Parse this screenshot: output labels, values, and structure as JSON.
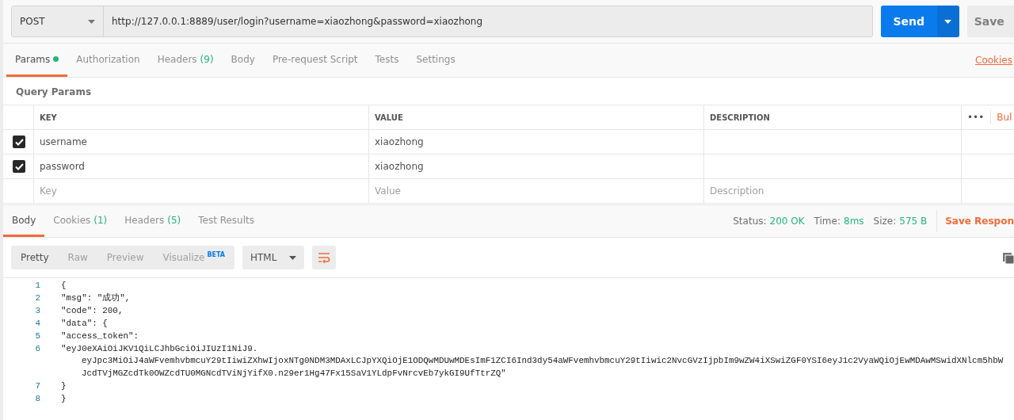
{
  "request": {
    "method": "POST",
    "url": "http://127.0.0.1:8889/user/login?username=xiaozhong&password=xiaozhong",
    "send": "Send",
    "save": "Save"
  },
  "request_tabs": [
    {
      "label": "Params",
      "dot": true,
      "selected": true
    },
    {
      "label": "Authorization",
      "dot": false,
      "selected": false
    },
    {
      "label": "Headers",
      "count": "(9)",
      "dot": false,
      "selected": false
    },
    {
      "label": "Body",
      "dot": false,
      "selected": false
    },
    {
      "label": "Pre-request Script",
      "dot": false,
      "selected": false
    },
    {
      "label": "Tests",
      "dot": false,
      "selected": false
    },
    {
      "label": "Settings",
      "dot": false,
      "selected": false
    }
  ],
  "cookies_link": "Cookies",
  "query_params": {
    "title": "Query Params",
    "columns": [
      "KEY",
      "VALUE",
      "DESCRIPTION"
    ],
    "more": "•••",
    "bulk_edit": "Bul",
    "rows": [
      {
        "checked": true,
        "key": "username",
        "value": "xiaozhong"
      },
      {
        "checked": true,
        "key": "password",
        "value": "xiaozhong"
      }
    ],
    "new_row": {
      "key_placeholder": "Key",
      "value_placeholder": "Value",
      "description_placeholder": "Description"
    }
  },
  "response_tabs": [
    {
      "label": "Body",
      "selected": true
    },
    {
      "label": "Cookies",
      "count": "(1)",
      "selected": false
    },
    {
      "label": "Headers",
      "count": "(5)",
      "selected": false
    },
    {
      "label": "Test Results",
      "selected": false
    }
  ],
  "response_stats": [
    {
      "label": "Status:",
      "value": "200 OK"
    },
    {
      "label": "Time:",
      "value": "8ms"
    },
    {
      "label": "Size:",
      "value": "575 B"
    }
  ],
  "save_response": "Save Respon",
  "view_modes": [
    {
      "label": "Pretty",
      "selected": true
    },
    {
      "label": "Raw",
      "selected": false
    },
    {
      "label": "Preview",
      "selected": false
    },
    {
      "label": "Visualize",
      "badge": "BETA",
      "selected": false
    }
  ],
  "format": "HTML",
  "code_lines": [
    {
      "number": "1",
      "text": [
        "{"
      ]
    },
    {
      "number": "2",
      "text": [
        "\"msg\": \"成功\","
      ]
    },
    {
      "number": "3",
      "text": [
        "\"code\": 200,"
      ]
    },
    {
      "number": "4",
      "text": [
        "\"data\": {"
      ]
    },
    {
      "number": "5",
      "text": [
        "\"access_token\":"
      ]
    },
    {
      "number": "6",
      "text": [
        "\"eyJ0eXAiOiJKV1QiLCJhbGciOiJIUzI1NiJ9.",
        "eyJpc3MiOiJ4aWFvemhvbmcuY29tIiwiZXhwIjoxNTg0NDM3MDAxLCJpYXQiOjE1ODQwMDUwMDEsImF1ZCI6Ind3dy54aWFvemhvbmcuY29tIiwic2NvcGVzIjpbIm9wZW4iXSwiZGF0YSI6eyJ1c2VyaWQiOjEwMDAwMSwidXNlcm5hbW",
        "JcdTVjMGZcdTk0OWZcdTU0MGNcdTViNjYifX0.n29er1Hg47Fx15SaV1YLdpFvNrcvEb7ykGI9UfTtrZQ\""
      ]
    },
    {
      "number": "7",
      "text": [
        "}"
      ]
    },
    {
      "number": "8",
      "text": [
        "}"
      ]
    }
  ]
}
